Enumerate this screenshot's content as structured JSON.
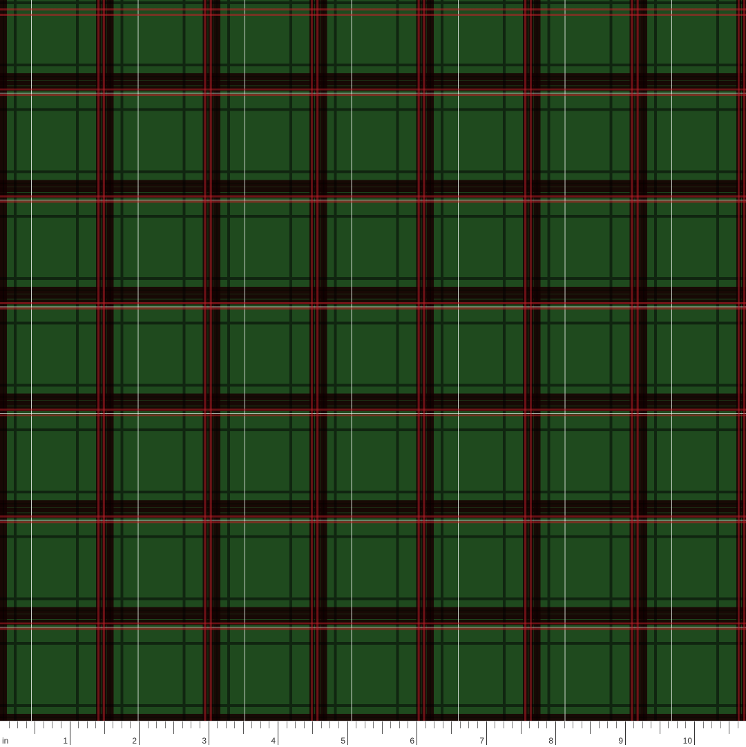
{
  "fabric": {
    "pattern": "tartan plaid",
    "colors": {
      "ground": "#1f4a1e",
      "red": "#c8202a",
      "dark": "#102510",
      "pinstripe": "#ebf0eb"
    }
  },
  "ruler": {
    "unit": "in",
    "labels": [
      "1",
      "2",
      "3",
      "4",
      "5",
      "6",
      "7",
      "8",
      "9",
      "10"
    ]
  }
}
